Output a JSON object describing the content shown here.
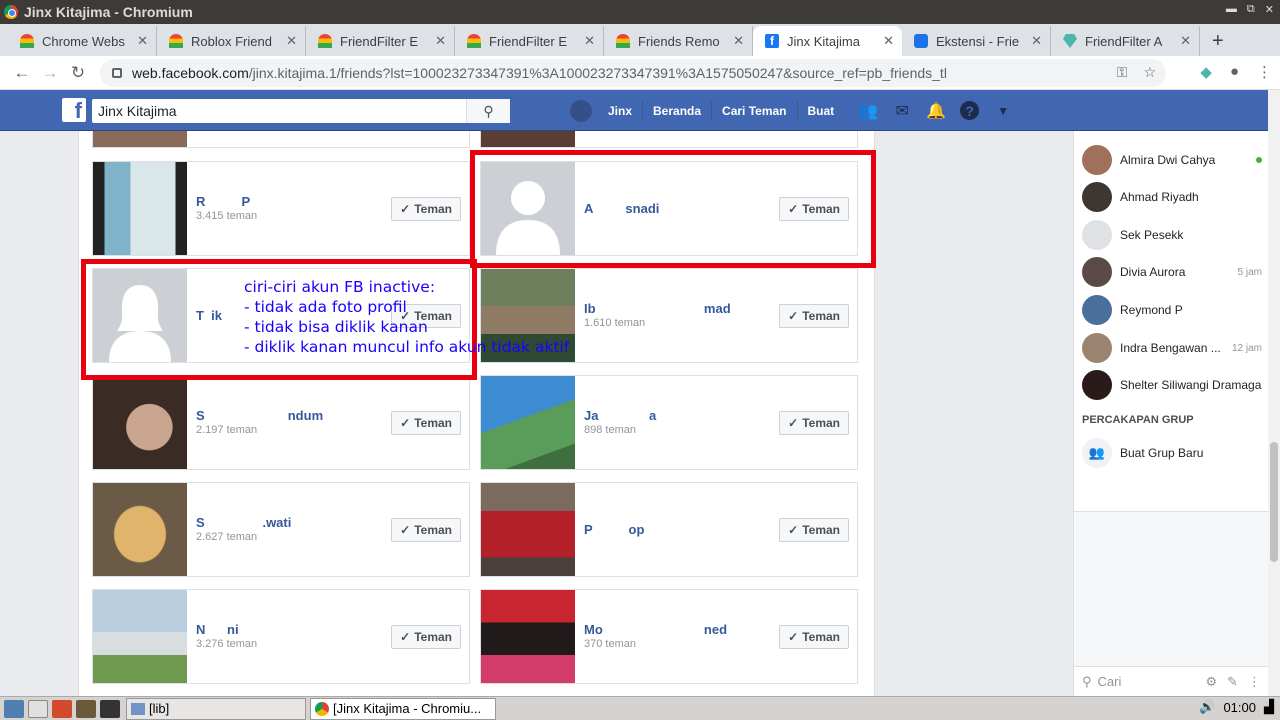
{
  "window": {
    "title": "Jinx Kitajima - Chromium"
  },
  "tabs": [
    {
      "label": "Chrome Webs",
      "icon": "rainbow-favicon"
    },
    {
      "label": "Roblox Friend",
      "icon": "rainbow-favicon"
    },
    {
      "label": "FriendFilter E",
      "icon": "rainbow-favicon"
    },
    {
      "label": "FriendFilter E",
      "icon": "rainbow-favicon"
    },
    {
      "label": "Friends Remo",
      "icon": "rainbow-favicon"
    },
    {
      "label": "Jinx Kitajima",
      "icon": "facebook-favicon",
      "active": true
    },
    {
      "label": "Ekstensi - Frie",
      "icon": "puzzle-favicon"
    },
    {
      "label": "FriendFilter A",
      "icon": "gem-favicon"
    }
  ],
  "omnibox": {
    "host": "web.facebook.com",
    "path": "/jinx.kitajima.1/friends?lst=100023273347391%3A100023273347391%3A1575050247&source_ref=pb_friends_tl"
  },
  "fb": {
    "search_value": "Jinx Kitajima",
    "nav": [
      "Jinx",
      "Beranda",
      "Cari Teman",
      "Buat"
    ]
  },
  "friends": [
    {
      "name": "R          P",
      "count": "3.415 teman",
      "button": "Teman"
    },
    {
      "name": "A         snadi",
      "count": "",
      "button": "Teman"
    },
    {
      "name": "T  ik",
      "count": "",
      "button": "Teman"
    },
    {
      "name": "Ib                              mad",
      "count": "1.610 teman",
      "button": "Teman"
    },
    {
      "name": "S                       ndum",
      "count": "2.197 teman",
      "button": "Teman"
    },
    {
      "name": "Ja              a",
      "count": "898 teman",
      "button": "Teman"
    },
    {
      "name": "S                .wati",
      "count": "2.627 teman",
      "button": "Teman"
    },
    {
      "name": "P          op",
      "count": "",
      "button": "Teman"
    },
    {
      "name": "N      ni",
      "count": "3.276 teman",
      "button": "Teman"
    },
    {
      "name": "Mo                            ned",
      "count": "370 teman",
      "button": "Teman"
    }
  ],
  "annotation": "ciri-ciri akun FB inactive:\n- tidak ada foto profil\n- tidak bisa diklik kanan\n- diklik kanan muncul info akun tidak aktif",
  "contacts": [
    {
      "name": "Almira Dwi Cahya",
      "time": "",
      "online": true
    },
    {
      "name": "Ahmad Riyadh",
      "time": ""
    },
    {
      "name": "Sek Pesekk",
      "time": ""
    },
    {
      "name": "Divia Aurora",
      "time": "5 jam"
    },
    {
      "name": "Reymond P",
      "time": ""
    },
    {
      "name": "Indra Bengawan ...",
      "time": "12 jam"
    },
    {
      "name": "Shelter Siliwangi Dramaga",
      "time": ""
    }
  ],
  "group_header": "PERCAKAPAN GRUP",
  "new_group": "Buat Grup Baru",
  "chat_search_placeholder": "Cari",
  "taskbar": {
    "folder_task": "[lib]",
    "browser_task": "[Jinx Kitajima - Chromiu...",
    "clock": "01:00"
  },
  "colors": {
    "fb_blue": "#4267b2",
    "link": "#365899",
    "annotation_red": "#e8000e",
    "annotation_blue": "#1b00ff"
  }
}
